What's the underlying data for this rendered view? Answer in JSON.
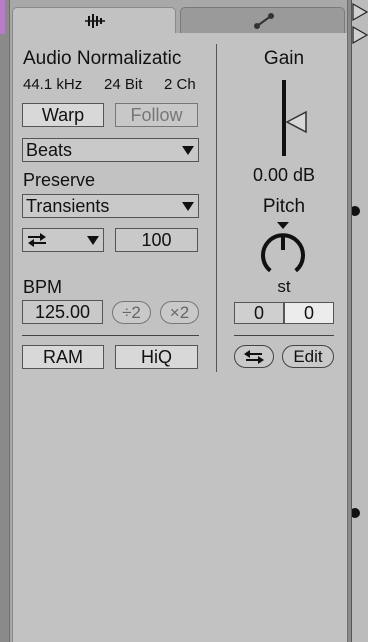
{
  "title": "Audio Normalizatic",
  "info": {
    "rate": "44.1 kHz",
    "depth": "24 Bit",
    "channels": "2 Ch"
  },
  "buttons": {
    "warp": "Warp",
    "follow": "Follow",
    "ram": "RAM",
    "hiq": "HiQ",
    "edit": "Edit"
  },
  "warp_mode": "Beats",
  "preserve": {
    "label": "Preserve",
    "value": "Transients"
  },
  "loop": {
    "value": "100"
  },
  "bpm": {
    "label": "BPM",
    "value": "125.00",
    "half": "÷2",
    "double": "×2"
  },
  "gain": {
    "label": "Gain",
    "value": "0.00 dB"
  },
  "pitch": {
    "label": "Pitch",
    "unit": "st",
    "semitones": "0",
    "cents": "0"
  },
  "colors": {
    "panel": "#c2c2c2",
    "clip": "#b67cc4"
  },
  "icons": {
    "sample_tab": "waveform-icon",
    "envelope_tab": "envelope-icon",
    "loop_mode": "repeat-arrows-icon",
    "reverse": "reverse-arrows-icon"
  }
}
